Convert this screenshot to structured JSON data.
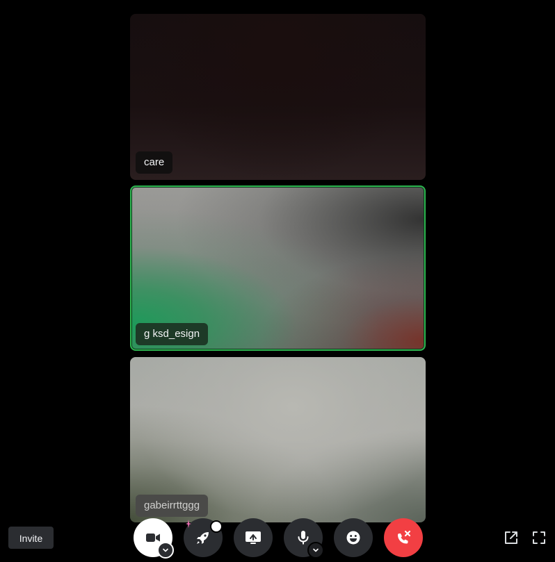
{
  "participants": [
    {
      "name": "care"
    },
    {
      "name": "g ksd_esign",
      "speaking": true
    },
    {
      "name": "gabeirrttggg"
    }
  ],
  "invite_button": {
    "label": "Invite"
  },
  "controls": {
    "camera": {
      "icon": "video-camera-icon",
      "state": "on"
    },
    "activities": {
      "icon": "rocket-icon"
    },
    "screen_share": {
      "icon": "screen-share-icon"
    },
    "microphone": {
      "icon": "microphone-icon"
    },
    "soundboard": {
      "icon": "emoji-icon"
    },
    "disconnect": {
      "icon": "hangup-phone-icon"
    }
  },
  "colors": {
    "speaking_border": "#2db34f",
    "disconnect": "#f23f43",
    "control_bg": "#2b2d31",
    "background": "#000000"
  }
}
